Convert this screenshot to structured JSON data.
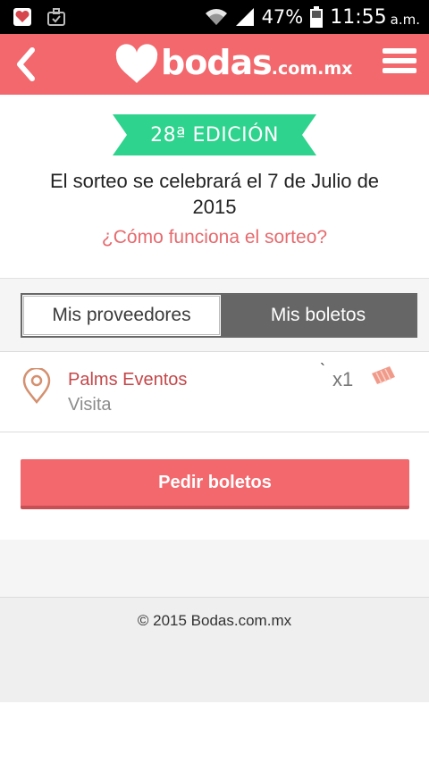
{
  "status_bar": {
    "battery_percent": "47%",
    "time": "11:55",
    "ampm": "a.m.",
    "icons": [
      "heart-notification-icon",
      "briefcase-check-icon",
      "wifi-icon",
      "signal-icon",
      "battery-icon"
    ]
  },
  "app_bar": {
    "back_icon": "chevron-left-icon",
    "brand_main": "bodas",
    "brand_suffix": ".com.mx",
    "menu_icon": "hamburger-menu-icon",
    "color": "#f2686d"
  },
  "intro": {
    "edition_badge": "28ª EDICIÓN",
    "badge_color": "#2ed38d",
    "raffle_date": "El sorteo se celebrará el 7 de Julio de 2015",
    "how_it_works_link": "¿Cómo funciona el sorteo?"
  },
  "tabs": [
    {
      "label": "Mis proveedores",
      "selected": true
    },
    {
      "label": "Mis boletos",
      "selected": false
    }
  ],
  "vendors": [
    {
      "name": "Palms Eventos",
      "type": "Visita",
      "ticket_count": "x1",
      "tick": "`",
      "icon": "location-pin-icon",
      "ticket_icon": "ticket-icon"
    }
  ],
  "actions": {
    "request_tickets": "Pedir boletos"
  },
  "footer": {
    "copyright": "© 2015 Bodas.com.mx"
  }
}
